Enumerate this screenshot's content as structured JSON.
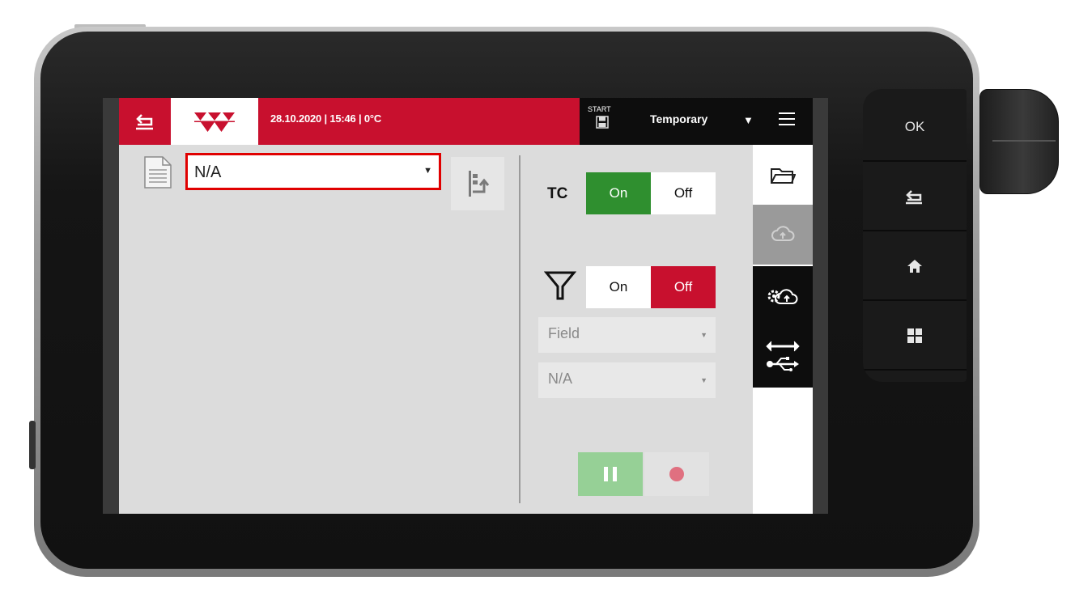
{
  "header": {
    "status_text": "28.10.2020 | 15:46 | 0°C",
    "start_label": "START",
    "profile_label": "Temporary"
  },
  "task": {
    "selected": "N/A"
  },
  "tc": {
    "label": "TC",
    "on_label": "On",
    "off_label": "Off",
    "state": "on"
  },
  "filter": {
    "on_label": "On",
    "off_label": "Off",
    "state": "off",
    "dropdown_1": "Field",
    "dropdown_2": "N/A"
  },
  "hardware_keys": {
    "ok_label": "OK"
  },
  "colors": {
    "brand_red": "#c8102e",
    "active_green": "#2f8f2f",
    "highlight_red": "#e00000"
  }
}
